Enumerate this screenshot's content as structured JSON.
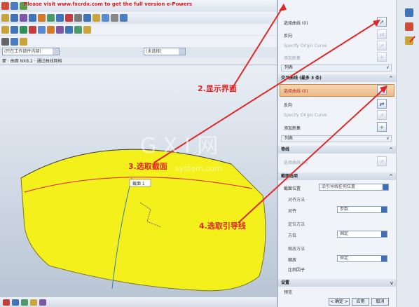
{
  "toolbar": {
    "notice": "Please visit www.fxcrdx.com to get the full version e-Powers"
  },
  "filter_bar": {
    "selection_filter": "(只在工作部件内部)",
    "snap_combo": "(未选择)"
  },
  "breadcrumb": "蒙 · 曲面 NX8.2 · 通过曲线网格",
  "dialog": {
    "primary_section": {
      "select_curve_label": "选择曲线 (0)",
      "reverse_label": "反向",
      "specify_origin_label": "Specify Origin Curve",
      "add_new_label": "添加新集",
      "list_label": "列表"
    },
    "cross_section": {
      "header": "交叉曲线 (最多 3 条)",
      "select_curve_label": "选择曲线 (0)",
      "reverse_label": "反向",
      "specify_origin_label": "Specify Origin Curve",
      "add_new_label": "添加新集",
      "list_label": "列表"
    },
    "spine_section": {
      "header": "脊线",
      "select_curve_label": "选择曲线 (0)"
    },
    "section_options": {
      "header": "截面选项",
      "position_label": "截面位置",
      "position_value": "沿引导线任何位置",
      "alignment_header": "对齐方法",
      "alignment_label": "对齐",
      "alignment_value": "参数",
      "orientation_header": "定位方法",
      "orientation_label": "方位",
      "orientation_value": "固定",
      "scaling_header": "缩放方法",
      "scaling_label": "缩放",
      "scaling_value": "恒定",
      "scale_factor_label": "比例因子"
    },
    "settings_header": "设置",
    "preview_label": "预览",
    "ok_label": "< 确定 >",
    "apply_label": "应用",
    "cancel_label": "取消"
  },
  "viewport": {
    "section_tag": "截面 1"
  },
  "annotations": {
    "step2": "2.显示界面",
    "step3": "3.选取截面",
    "step4": "4.选取引导线"
  },
  "site_watermark": {
    "brand": "G X I 网",
    "domain": "system.com"
  },
  "colors": {
    "surface_fill": "#f3f01c",
    "surface_edge": "#7a7a20",
    "annotation": "#e02727",
    "active_row": "#efc79a"
  },
  "icons": {
    "pick": "pick-curve-icon",
    "reverse": "reverse-icon",
    "add_set": "add-set-icon"
  }
}
